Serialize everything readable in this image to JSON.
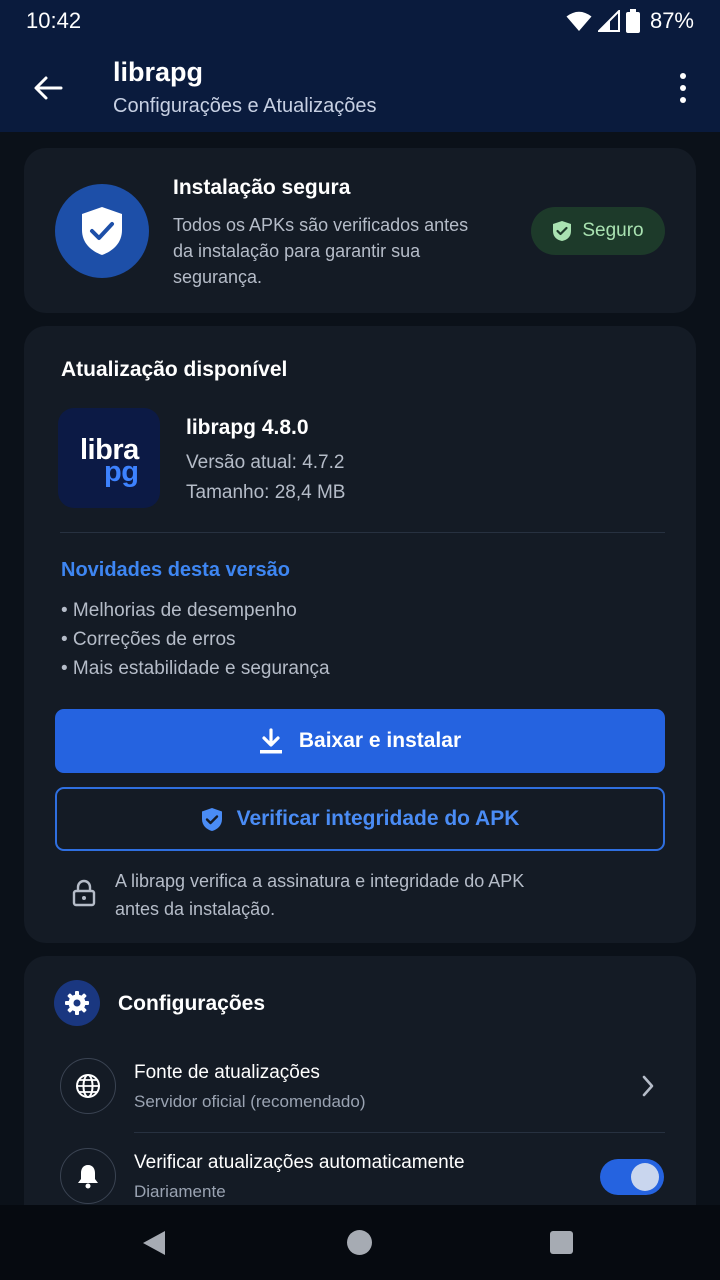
{
  "status_bar": {
    "time": "10:42",
    "battery": "87%"
  },
  "app_bar": {
    "title": "librapg",
    "subtitle": "Configurações e Atualizações"
  },
  "secure_card": {
    "title": "Instalação segura",
    "description": "Todos os APKs são verificados antes da instalação para garantir sua segurança.",
    "badge": "Seguro"
  },
  "update_card": {
    "title": "Atualização disponível",
    "logo": {
      "line1": "libra",
      "line2": "pg"
    },
    "app_name": "librapg 4.8.0",
    "current_version": "Versão atual: 4.7.2",
    "size": "Tamanho: 28,4 MB",
    "news_title": "Novidades desta versão",
    "news_items": [
      "• Melhorias de desempenho",
      "• Correções de erros",
      "• Mais estabilidade e segurança"
    ],
    "download_button": "Baixar e instalar",
    "verify_button": "Verificar integridade do APK",
    "note": "A librapg verifica a assinatura e integridade do APK antes da instalação."
  },
  "settings_card": {
    "title": "Configurações",
    "rows": [
      {
        "title": "Fonte de atualizações",
        "subtitle": "Servidor oficial (recomendado)",
        "icon": "globe-icon"
      },
      {
        "title": "Verificar atualizações automaticamente",
        "subtitle": "Diariamente",
        "icon": "bell-icon",
        "toggle_on": true
      }
    ]
  },
  "colors": {
    "accent": "#2563e0",
    "header": "#0a1b3d",
    "success": "#a9e2b1",
    "card": "#141b25"
  }
}
